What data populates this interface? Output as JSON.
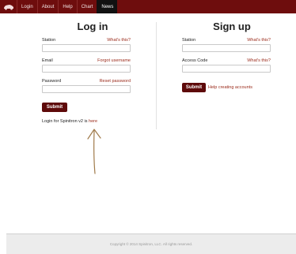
{
  "nav": {
    "items": [
      {
        "label": "Login"
      },
      {
        "label": "About"
      },
      {
        "label": "Help"
      },
      {
        "label": "Chart"
      },
      {
        "label": "News"
      }
    ],
    "active_index": 4
  },
  "login": {
    "title": "Log in",
    "station_label": "Station",
    "station_help": "What's this?",
    "station_value": "",
    "email_label": "Email",
    "email_help": "Forgot username",
    "email_value": "",
    "password_label": "Password",
    "password_help": "Reset password",
    "password_value": "",
    "submit_label": "Submit",
    "legacy_text": "Login for Spinitron v2 is",
    "legacy_link": "here"
  },
  "signup": {
    "title": "Sign up",
    "station_label": "Station",
    "station_help": "What's this?",
    "station_value": "",
    "code_label": "Access Code",
    "code_help": "What's this?",
    "code_value": "",
    "submit_label": "Submit",
    "help_link": "Help creating accounts"
  },
  "footer": {
    "copyright": "Copyright © 2014 Spinitron, LLC. All rights reserved."
  },
  "colors": {
    "brand": "#6e0d0d",
    "button": "#5e0a0a",
    "link": "#9a2a1a",
    "annotation_arrow": "#a07a4a"
  }
}
